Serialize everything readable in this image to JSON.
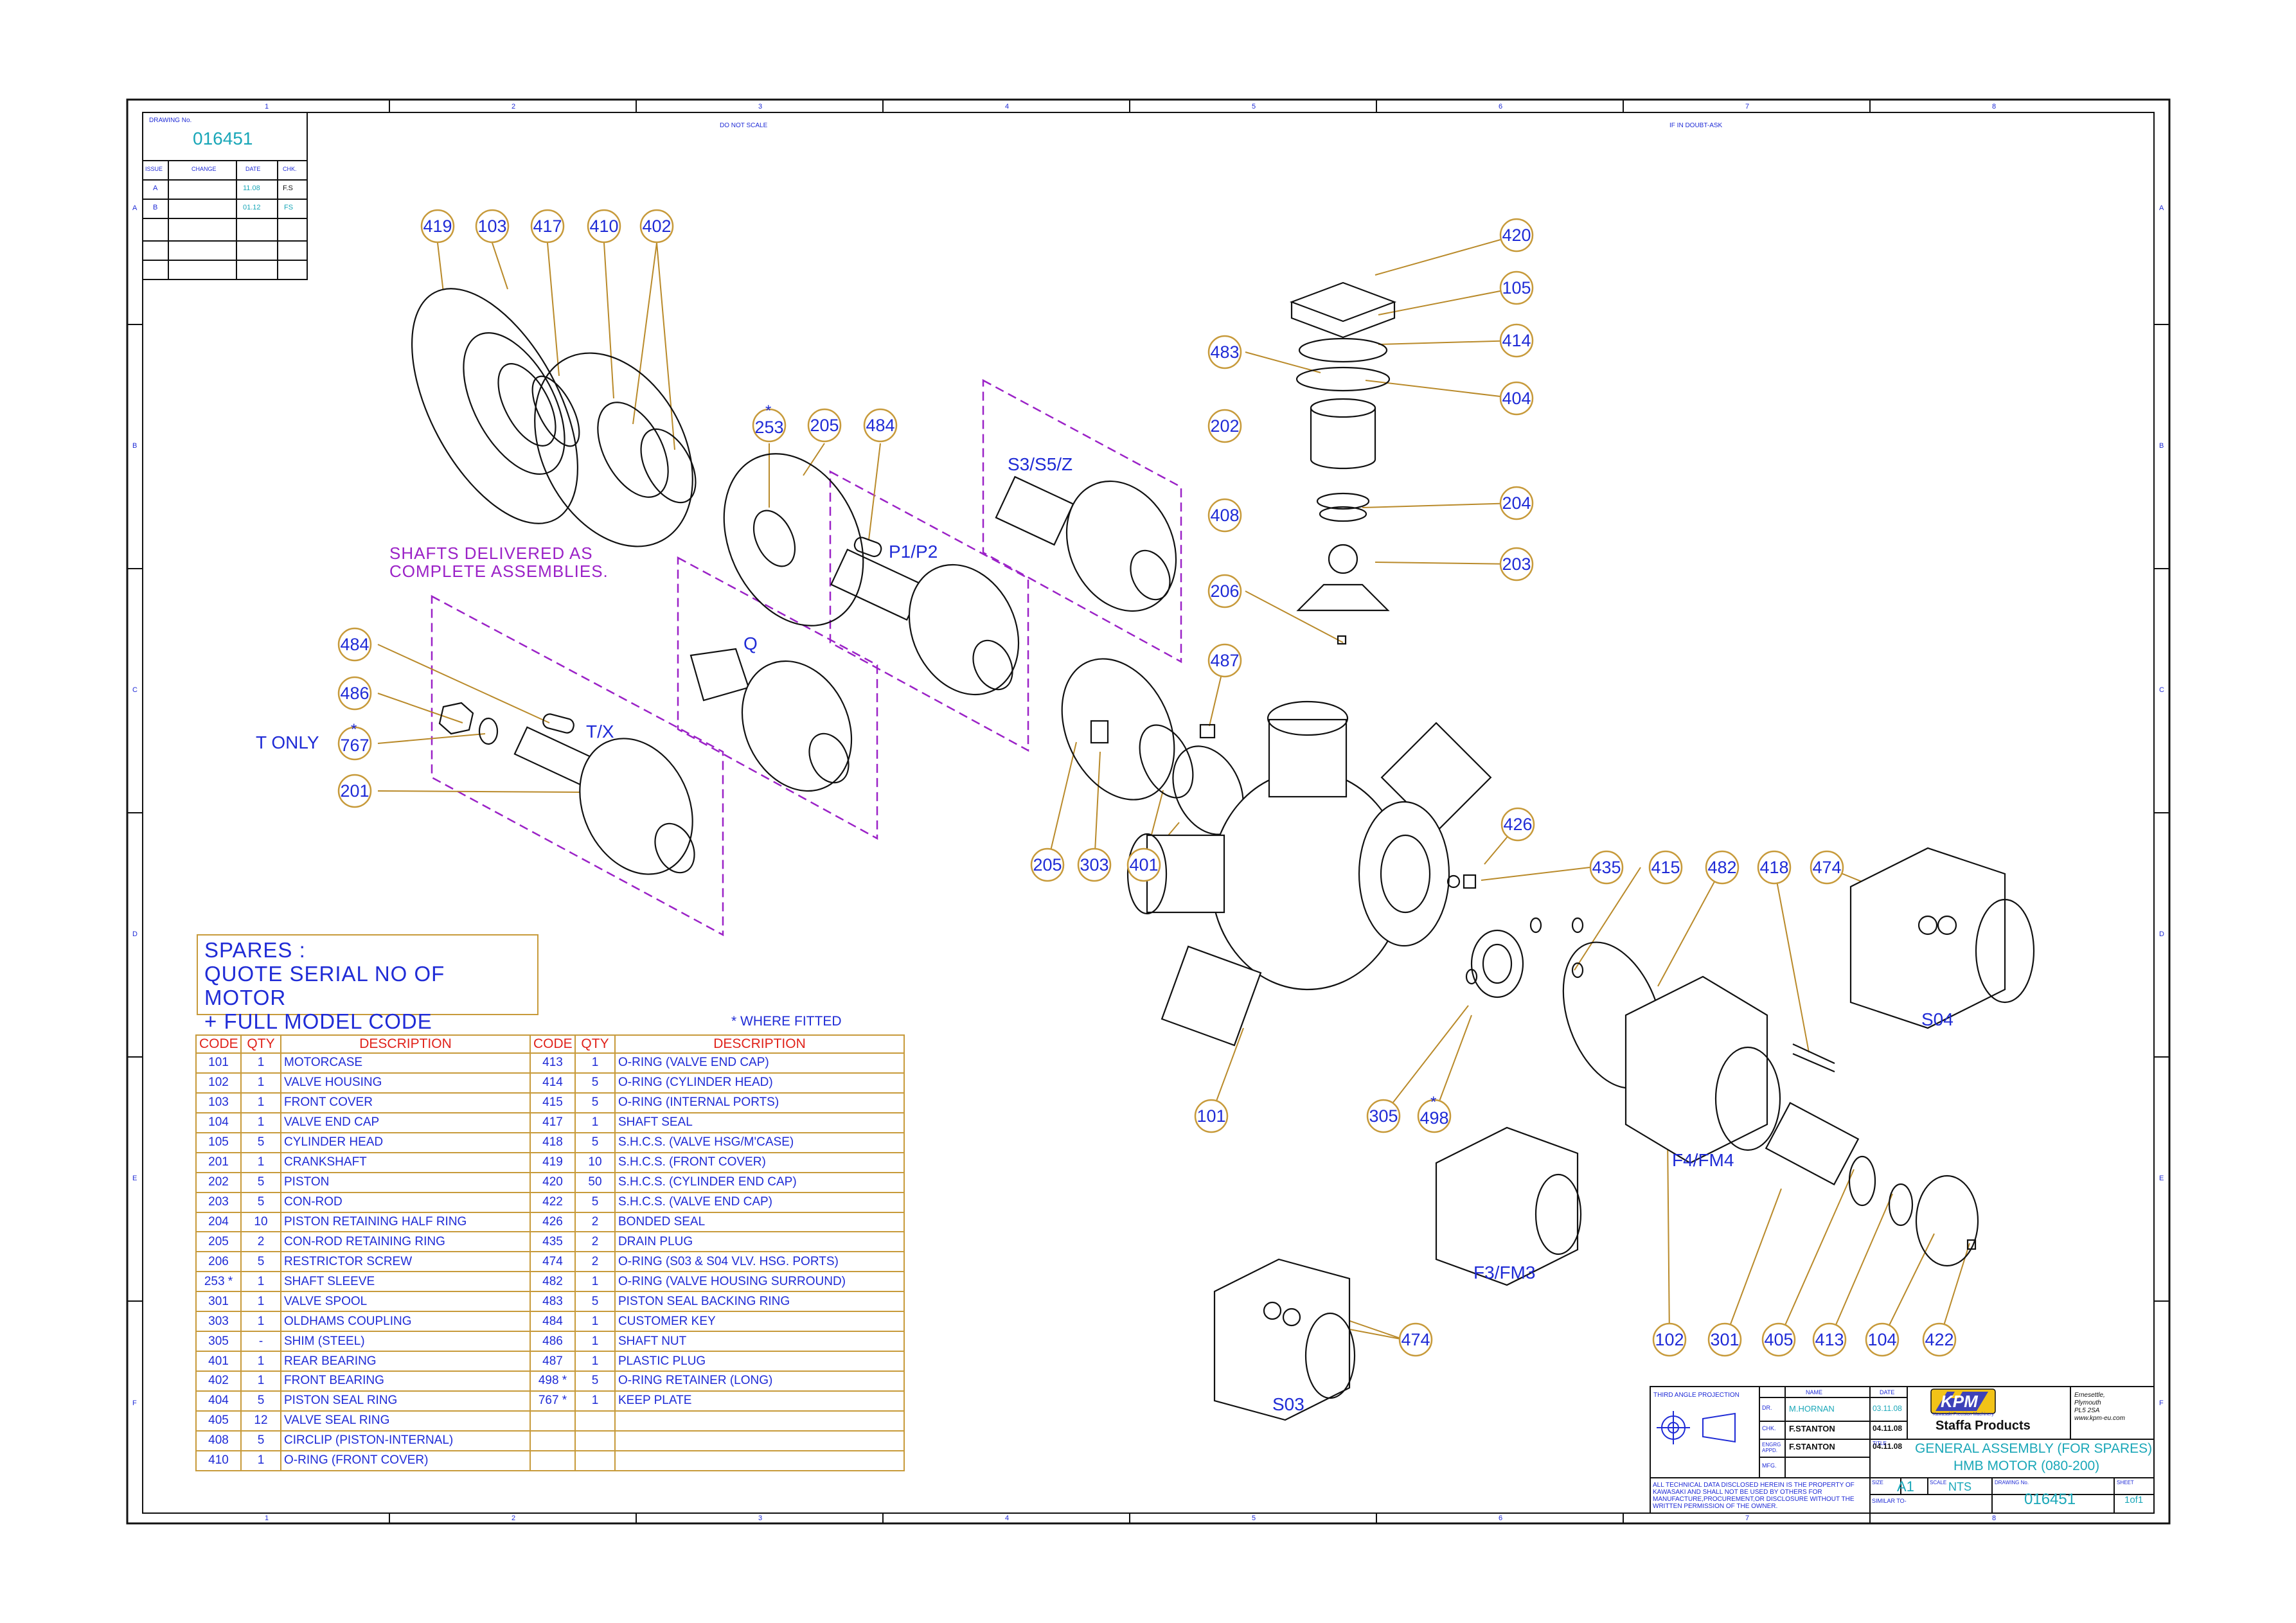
{
  "drawing": {
    "drawing_no_label": "DRAWING No.",
    "drawing_no": "016451",
    "do_not_scale": "DO NOT SCALE",
    "if_in_doubt": "IF IN DOUBT-ASK",
    "revisions_header": {
      "issue": "ISSUE",
      "change": "CHANGE",
      "date": "DATE",
      "chk": "CHK."
    },
    "revisions": [
      {
        "issue": "A",
        "change": "",
        "date": "11.08",
        "chk": "F.S"
      },
      {
        "issue": "B",
        "change": "",
        "date": "01.12",
        "chk": "FS"
      }
    ],
    "col_numbers": [
      "1",
      "2",
      "3",
      "4",
      "5",
      "6",
      "7",
      "8"
    ],
    "row_letters": [
      "A",
      "B",
      "C",
      "D",
      "E",
      "F"
    ]
  },
  "parts": {
    "callouts": {
      "c419": "419",
      "c103": "103",
      "c417": "417",
      "c410": "410",
      "c402": "402",
      "c253": "253",
      "c205a": "205",
      "c484a": "484",
      "c420": "420",
      "c105": "105",
      "c483": "483",
      "c414": "414",
      "c404": "404",
      "c202": "202",
      "c408": "408",
      "c204": "204",
      "c203": "203",
      "c206": "206",
      "c484b": "484",
      "c486": "486",
      "c767": "767",
      "c201": "201",
      "c487": "487",
      "c205b": "205",
      "c303": "303",
      "c401": "401",
      "c426": "426",
      "c435": "435",
      "c415": "415",
      "c482": "482",
      "c418": "418",
      "c474a": "474",
      "c101": "101",
      "c305": "305",
      "c498": "498",
      "c102": "102",
      "c301": "301",
      "c405": "405",
      "c413": "413",
      "c104": "104",
      "c422": "422",
      "c474b": "474"
    },
    "star": "*"
  },
  "labels": {
    "shafts_note_1": "SHAFTS DELIVERED AS",
    "shafts_note_2": "COMPLETE ASSEMBLIES.",
    "s3_s5_z": "S3/S5/Z",
    "p1_p2": "P1/P2",
    "q": "Q",
    "t_x": "T/X",
    "t_only": "T ONLY",
    "s04": "S04",
    "f4_fm4": "F4/FM4",
    "f3_fm3": "F3/FM3",
    "s03": "S03",
    "where_fitted": "* WHERE FITTED"
  },
  "spares_note": {
    "line1": "SPARES :",
    "line2": "QUOTE SERIAL NO OF MOTOR",
    "line3": "+ FULL MODEL CODE"
  },
  "spares_table": {
    "headers": {
      "code": "CODE",
      "qty": "QTY",
      "desc": "DESCRIPTION"
    },
    "rows": [
      [
        "101",
        "1",
        "MOTORCASE",
        "413",
        "1",
        "O-RING (VALVE END CAP)"
      ],
      [
        "102",
        "1",
        "VALVE HOUSING",
        "414",
        "5",
        "O-RING (CYLINDER HEAD)"
      ],
      [
        "103",
        "1",
        "FRONT COVER",
        "415",
        "5",
        "O-RING (INTERNAL PORTS)"
      ],
      [
        "104",
        "1",
        "VALVE END CAP",
        "417",
        "1",
        "SHAFT SEAL"
      ],
      [
        "105",
        "5",
        "CYLINDER HEAD",
        "418",
        "5",
        "S.H.C.S. (VALVE HSG/M'CASE)"
      ],
      [
        "201",
        "1",
        "CRANKSHAFT",
        "419",
        "10",
        "S.H.C.S. (FRONT COVER)"
      ],
      [
        "202",
        "5",
        "PISTON",
        "420",
        "50",
        "S.H.C.S. (CYLINDER END CAP)"
      ],
      [
        "203",
        "5",
        "CON-ROD",
        "422",
        "5",
        "S.H.C.S. (VALVE END CAP)"
      ],
      [
        "204",
        "10",
        "PISTON RETAINING HALF RING",
        "426",
        "2",
        "BONDED SEAL"
      ],
      [
        "205",
        "2",
        "CON-ROD RETAINING RING",
        "435",
        "2",
        "DRAIN PLUG"
      ],
      [
        "206",
        "5",
        "RESTRICTOR SCREW",
        "474",
        "2",
        "O-RING (S03 & S04 VLV. HSG. PORTS)"
      ],
      [
        "253 *",
        "1",
        "SHAFT SLEEVE",
        "482",
        "1",
        "O-RING (VALVE HOUSING SURROUND)"
      ],
      [
        "301",
        "1",
        "VALVE SPOOL",
        "483",
        "5",
        "PISTON SEAL BACKING RING"
      ],
      [
        "303",
        "1",
        "OLDHAMS COUPLING",
        "484",
        "1",
        "CUSTOMER KEY"
      ],
      [
        "305",
        "-",
        "SHIM (STEEL)",
        "486",
        "1",
        "SHAFT NUT"
      ],
      [
        "401",
        "1",
        "REAR BEARING",
        "487",
        "1",
        "PLASTIC PLUG"
      ],
      [
        "402",
        "1",
        "FRONT BEARING",
        "498 *",
        "5",
        "O-RING RETAINER (LONG)"
      ],
      [
        "404",
        "5",
        "PISTON SEAL RING",
        "767 *",
        "1",
        "KEEP PLATE"
      ],
      [
        "405",
        "12",
        "VALVE SEAL RING",
        "",
        "",
        ""
      ],
      [
        "408",
        "5",
        "CIRCLIP (PISTON-INTERNAL)",
        "",
        "",
        ""
      ],
      [
        "410",
        "1",
        "O-RING (FRONT COVER)",
        "",
        "",
        ""
      ]
    ]
  },
  "title_block": {
    "projection": "THIRD ANGLE PROJECTION",
    "name_hdr": "NAME",
    "date_hdr": "DATE",
    "dr": "DR.",
    "dr_name": "M.HORNAN",
    "dr_date": "03.11.08",
    "chk": "CHK.",
    "chk_name": "F.STANTON",
    "chk_date": "04.11.08",
    "engrg": "ENGRG APPD.",
    "engrg_name": "F.STANTON",
    "engrg_date": "04.11.08",
    "mfg": "MFG.",
    "logo": "KPM",
    "logo_sub": "Kawasaki Precision Machinery",
    "company": "Staffa Products",
    "address_1": "Ernesettle,",
    "address_2": "Plymouth",
    "address_3": "PL5 2SA",
    "address_4": "www.kpm-eu.com",
    "title_hdr": "TITLE",
    "title_1": "GENERAL ASSEMBLY (FOR SPARES)",
    "title_2": "HMB MOTOR (080-200)",
    "disclaimer": "ALL TECHNICAL DATA DISCLOSED HEREIN IS THE PROPERTY OF KAWASAKI AND SHALL NOT BE USED BY OTHERS FOR MANUFACTURE,PROCUREMENT,OR DISCLOSURE WITHOUT THE WRITTEN PERMISSION OF THE OWNER.",
    "size_hdr": "SIZE",
    "size": "A1",
    "scale_hdr": "SCALE",
    "scale": "NTS",
    "similar_to": "SIMILAR TO-",
    "drawing_no_hdr": "DRAWING No.",
    "drawing_no": "016451",
    "sheet_hdr": "SHEET",
    "sheet": "1of1"
  },
  "colors": {
    "callout_ring": "#c79a3a",
    "callout_text": "#1f2bd6",
    "leader": "#b98a2a",
    "assembly_box": "#9b22c7",
    "red_header": "#e0221a",
    "outline": "#111111"
  }
}
